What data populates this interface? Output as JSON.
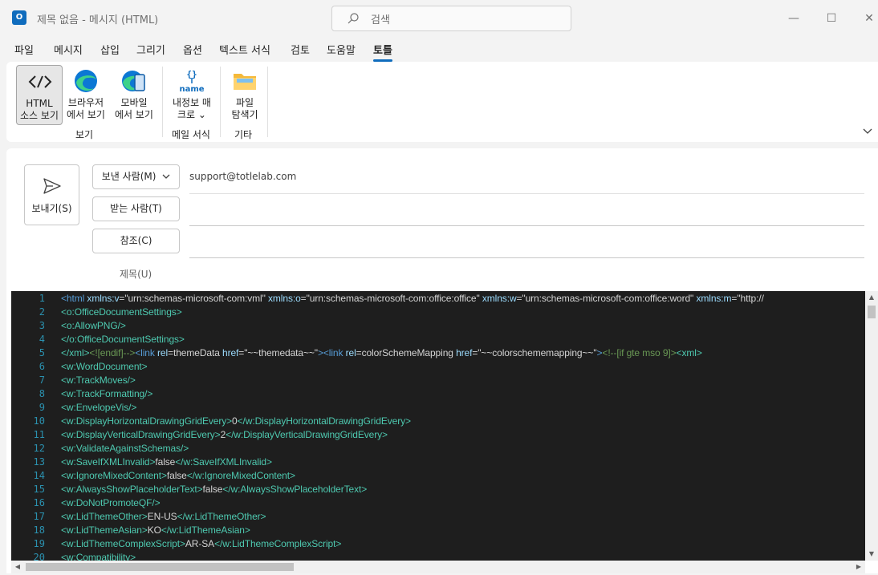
{
  "window": {
    "title": "제목 없음  -  메시지 (HTML)",
    "search_placeholder": "검색",
    "minimize": "—",
    "maximize": "☐",
    "close": "✕"
  },
  "tabs": [
    "파일",
    "메시지",
    "삽입",
    "그리기",
    "옵션",
    "텍스트 서식",
    "검토",
    "도움말",
    "토틀"
  ],
  "active_tab": "토틀",
  "ribbon": {
    "buttons": [
      {
        "label": "HTML\n소스 보기",
        "icon": "code-icon"
      },
      {
        "label": "브라우저\n에서 보기",
        "icon": "edge-icon"
      },
      {
        "label": "모바일\n에서 보기",
        "icon": "mobile-edge-icon"
      },
      {
        "label": "내정보 매\n크로 ⌄",
        "icon": "name-macro-icon"
      },
      {
        "label": "파일\n탐색기",
        "icon": "folder-icon"
      }
    ],
    "groups": [
      "보기",
      "메일 서식",
      "기타"
    ]
  },
  "compose": {
    "send_label": "보내기(S)",
    "from_label": "보낸 사람(M)",
    "from_value": "support@totlelab.com",
    "to_label": "받는 사람(T)",
    "cc_label": "참조(C)",
    "subject_label": "제목(U)"
  },
  "code_lines": [
    {
      "n": "1",
      "parts": [
        [
          "t-tag2",
          "<html "
        ],
        [
          "t-attr",
          "xmlns:v"
        ],
        [
          "t-def",
          "="
        ],
        [
          "t-def",
          "\"urn:schemas-microsoft-com:vml\" "
        ],
        [
          "t-attr",
          "xmlns:o"
        ],
        [
          "t-def",
          "=\"urn:schemas-microsoft-com:office:office\" "
        ],
        [
          "t-attr",
          "xmlns:w"
        ],
        [
          "t-def",
          "=\"urn:schemas-microsoft-com:office:word\" "
        ],
        [
          "t-attr",
          "xmlns:m"
        ],
        [
          "t-def",
          "=\"http://"
        ]
      ]
    },
    {
      "n": "2",
      "parts": [
        [
          "t-tag",
          "<o:OfficeDocumentSettings>"
        ]
      ]
    },
    {
      "n": "3",
      "parts": [
        [
          "t-tag",
          "<o:AllowPNG/>"
        ]
      ]
    },
    {
      "n": "4",
      "parts": [
        [
          "t-tag",
          "</o:OfficeDocumentSettings>"
        ]
      ]
    },
    {
      "n": "5",
      "parts": [
        [
          "t-tag",
          "</xml>"
        ],
        [
          "t-com",
          "<![endif]-->"
        ],
        [
          "t-tag2",
          "<link "
        ],
        [
          "t-attr",
          "rel"
        ],
        [
          "t-def",
          "=themeData "
        ],
        [
          "t-attr",
          "href"
        ],
        [
          "t-def",
          "=\"~~themedata~~\""
        ],
        [
          "t-tag2",
          "><link "
        ],
        [
          "t-attr",
          "rel"
        ],
        [
          "t-def",
          "=colorSchemeMapping "
        ],
        [
          "t-attr",
          "href"
        ],
        [
          "t-def",
          "=\"~~colorschememapping~~\""
        ],
        [
          "t-tag2",
          ">"
        ],
        [
          "t-com",
          "<!--[if gte mso 9]>"
        ],
        [
          "t-tag",
          "<xml>"
        ]
      ]
    },
    {
      "n": "6",
      "parts": [
        [
          "t-tag",
          "<w:WordDocument>"
        ]
      ]
    },
    {
      "n": "7",
      "parts": [
        [
          "t-tag",
          "<w:TrackMoves/>"
        ]
      ]
    },
    {
      "n": "8",
      "parts": [
        [
          "t-tag",
          "<w:TrackFormatting/>"
        ]
      ]
    },
    {
      "n": "9",
      "parts": [
        [
          "t-tag",
          "<w:EnvelopeVis/>"
        ]
      ]
    },
    {
      "n": "10",
      "parts": [
        [
          "t-tag",
          "<w:DisplayHorizontalDrawingGridEvery>"
        ],
        [
          "t-def",
          "0"
        ],
        [
          "t-tag",
          "</w:DisplayHorizontalDrawingGridEvery>"
        ]
      ]
    },
    {
      "n": "11",
      "parts": [
        [
          "t-tag",
          "<w:DisplayVerticalDrawingGridEvery>"
        ],
        [
          "t-def",
          "2"
        ],
        [
          "t-tag",
          "</w:DisplayVerticalDrawingGridEvery>"
        ]
      ]
    },
    {
      "n": "12",
      "parts": [
        [
          "t-tag",
          "<w:ValidateAgainstSchemas/>"
        ]
      ]
    },
    {
      "n": "13",
      "parts": [
        [
          "t-tag",
          "<w:SaveIfXMLInvalid>"
        ],
        [
          "t-def",
          "false"
        ],
        [
          "t-tag",
          "</w:SaveIfXMLInvalid>"
        ]
      ]
    },
    {
      "n": "14",
      "parts": [
        [
          "t-tag",
          "<w:IgnoreMixedContent>"
        ],
        [
          "t-def",
          "false"
        ],
        [
          "t-tag",
          "</w:IgnoreMixedContent>"
        ]
      ]
    },
    {
      "n": "15",
      "parts": [
        [
          "t-tag",
          "<w:AlwaysShowPlaceholderText>"
        ],
        [
          "t-def",
          "false"
        ],
        [
          "t-tag",
          "</w:AlwaysShowPlaceholderText>"
        ]
      ]
    },
    {
      "n": "16",
      "parts": [
        [
          "t-tag",
          "<w:DoNotPromoteQF/>"
        ]
      ]
    },
    {
      "n": "17",
      "parts": [
        [
          "t-tag",
          "<w:LidThemeOther>"
        ],
        [
          "t-def",
          "EN-US"
        ],
        [
          "t-tag",
          "</w:LidThemeOther>"
        ]
      ]
    },
    {
      "n": "18",
      "parts": [
        [
          "t-tag",
          "<w:LidThemeAsian>"
        ],
        [
          "t-def",
          "KO"
        ],
        [
          "t-tag",
          "</w:LidThemeAsian>"
        ]
      ]
    },
    {
      "n": "19",
      "parts": [
        [
          "t-tag",
          "<w:LidThemeComplexScript>"
        ],
        [
          "t-def",
          "AR-SA"
        ],
        [
          "t-tag",
          "</w:LidThemeComplexScript>"
        ]
      ]
    },
    {
      "n": "20",
      "parts": [
        [
          "t-tag",
          "<w:Compatibility>"
        ]
      ]
    }
  ]
}
